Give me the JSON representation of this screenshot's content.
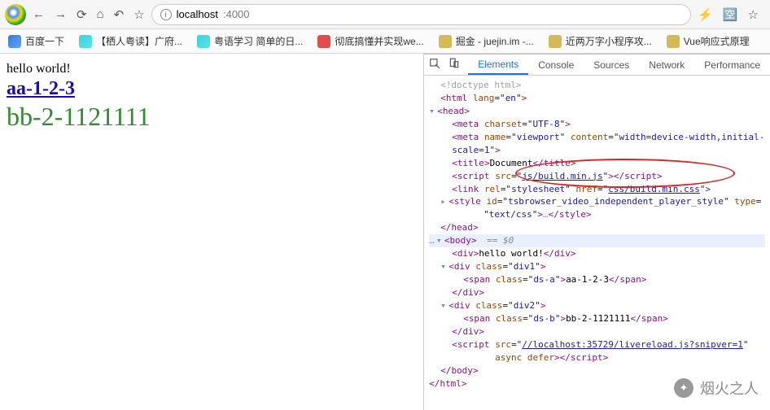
{
  "address": {
    "host": "localhost",
    "port": ":4000"
  },
  "bookmarks": [
    {
      "label": "百度一下"
    },
    {
      "label": "【栖人粤读】广府..."
    },
    {
      "label": "粤语学习 简单的日..."
    },
    {
      "label": "彻底搞懂并实现we..."
    },
    {
      "label": "掘金 - juejin.im -..."
    },
    {
      "label": "近两万字小程序攻..."
    },
    {
      "label": "Vue响应式原理"
    }
  ],
  "page": {
    "hello": "hello world!",
    "link": "aa-1-2-3",
    "bb": "bb-2-1121111"
  },
  "devtools": {
    "tabs": [
      "Elements",
      "Console",
      "Sources",
      "Network",
      "Performance"
    ],
    "activeTab": 0
  },
  "dom": {
    "doctype": "<!doctype html>",
    "htmlOpenAttr": "lang",
    "htmlOpenVal": "en",
    "metaCharsetAttr": "charset",
    "metaCharsetVal": "UTF-8",
    "metaViewportName": "name",
    "metaViewportNameVal": "viewport",
    "metaViewportContent": "content",
    "metaViewportContentVal": "width=device-width,initial-scale=1",
    "titleText": "Document",
    "scriptSrc": "src",
    "scriptSrcVal": "js/build.min.js",
    "linkRel": "rel",
    "linkRelVal": "stylesheet",
    "linkHref": "href",
    "linkHrefVal": "css/build.min.css",
    "styleId": "id",
    "styleIdVal": "tsbrowser_video_independent_player_style",
    "styleType": "type",
    "styleTypeVal": "text/css",
    "bodyEq": " == $0",
    "divHello": "hello world!",
    "div1Class": "div1",
    "spanA": "ds-a",
    "spanAText": "aa-1-2-3",
    "div2Class": "div2",
    "spanB": "ds-b",
    "spanBText": "bb-2-1121111",
    "liveSrcAttr": "src",
    "liveSrcVal": "//localhost:35729/livereload.js?snipver=1",
    "asyncDefer": "async defer"
  },
  "watermark": {
    "text": "烟火之人"
  }
}
